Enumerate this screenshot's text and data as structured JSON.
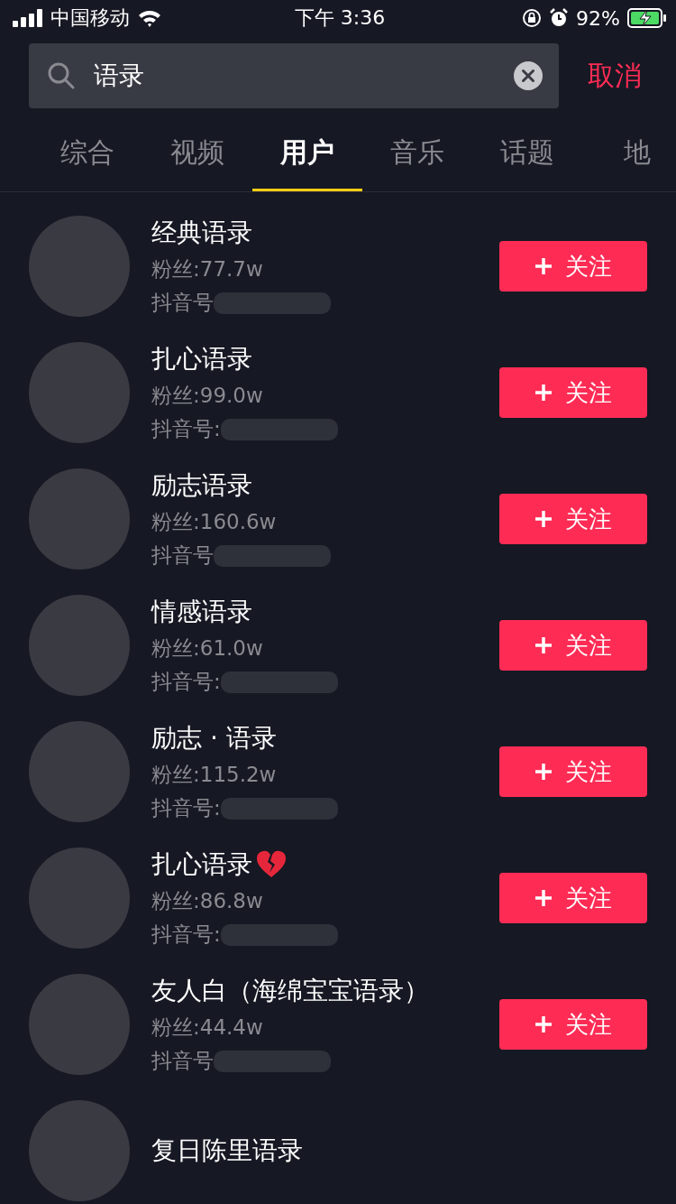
{
  "status_bar": {
    "carrier": "中国移动",
    "time": "下午 3:36",
    "battery": "92%"
  },
  "search": {
    "value": "语录",
    "cancel": "取消"
  },
  "tabs": [
    {
      "label": "综合",
      "selected": false
    },
    {
      "label": "视频",
      "selected": false
    },
    {
      "label": "用户",
      "selected": true
    },
    {
      "label": "音乐",
      "selected": false
    },
    {
      "label": "话题",
      "selected": false
    },
    {
      "label": "地",
      "selected": false
    }
  ],
  "users": [
    {
      "name": "经典语录",
      "fans": "粉丝:77.7w",
      "id_label": "抖音号",
      "badge_icon": false,
      "button": "关注"
    },
    {
      "name": "扎心语录",
      "fans": "粉丝:99.0w",
      "id_label": "抖音号:",
      "badge_icon": false,
      "button": "关注"
    },
    {
      "name": "励志语录",
      "fans": "粉丝:160.6w",
      "id_label": "抖音号",
      "badge_icon": false,
      "button": "关注"
    },
    {
      "name": "情感语录",
      "fans": "粉丝:61.0w",
      "id_label": "抖音号:",
      "badge_icon": false,
      "button": "关注"
    },
    {
      "name": "励志 · 语录",
      "fans": "粉丝:115.2w",
      "id_label": "抖音号:",
      "badge_icon": false,
      "button": "关注"
    },
    {
      "name": "扎心语录",
      "fans": "粉丝:86.8w",
      "id_label": "抖音号:",
      "badge_icon": true,
      "button": "关注"
    },
    {
      "name": "友人白（海绵宝宝语录）",
      "fans": "粉丝:44.4w",
      "id_label": "抖音号",
      "badge_icon": false,
      "button": "关注"
    },
    {
      "name": "复日陈里语录"
    }
  ]
}
